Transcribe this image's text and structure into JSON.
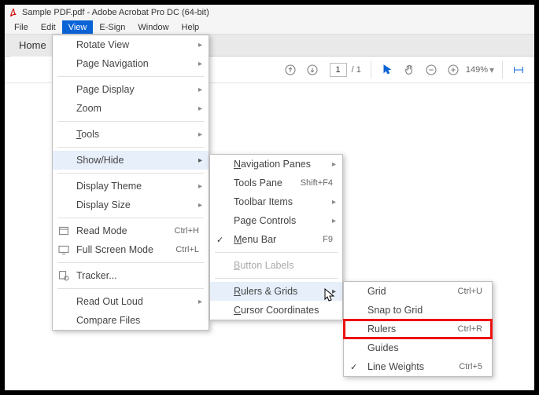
{
  "title": "Sample PDF.pdf - Adobe Acrobat Pro DC (64-bit)",
  "menubar": {
    "file": "File",
    "edit": "Edit",
    "view": "View",
    "esign": "E-Sign",
    "window": "Window",
    "help": "Help"
  },
  "tabs": {
    "home": "Home"
  },
  "toolbar": {
    "page_current": "1",
    "page_sep": "/",
    "page_total": "1",
    "zoom": "149%"
  },
  "view_menu": {
    "rotate": "Rotate View",
    "pagenav": "Page Navigation",
    "pagedisp": "Page Display",
    "zoom": "Zoom",
    "tools": "Tools",
    "showhide": "Show/Hide",
    "theme": "Display Theme",
    "size": "Display Size",
    "read": "Read Mode",
    "read_sc": "Ctrl+H",
    "full": "Full Screen Mode",
    "full_sc": "Ctrl+L",
    "tracker": "Tracker...",
    "readout": "Read Out Loud",
    "compare": "Compare Files"
  },
  "showhide_menu": {
    "navpanes": "Navigation Panes",
    "toolspane": "Tools Pane",
    "toolspane_sc": "Shift+F4",
    "toolbaritems": "Toolbar Items",
    "pagecontrols": "Page Controls",
    "menubar": "Menu Bar",
    "menubar_sc": "F9",
    "buttonlabels": "Button Labels",
    "rulersgrids": "Rulers & Grids",
    "cursorcoords": "Cursor Coordinates"
  },
  "rulers_menu": {
    "grid": "Grid",
    "grid_sc": "Ctrl+U",
    "snap": "Snap to Grid",
    "rulers": "Rulers",
    "rulers_sc": "Ctrl+R",
    "guides": "Guides",
    "lineweights": "Line Weights",
    "lineweights_sc": "Ctrl+5"
  }
}
